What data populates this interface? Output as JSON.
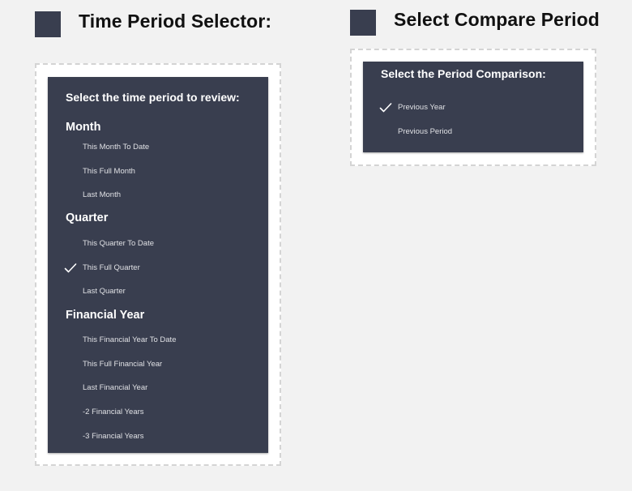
{
  "colors": {
    "panel_bg": "#393e4f",
    "page_bg": "#f2f2f2",
    "title_text": "#111111",
    "option_text": "#dfe0e4"
  },
  "time_selector": {
    "title": "Time Period Selector:",
    "heading": "Select the time period to review:",
    "groups": [
      {
        "label": "Month",
        "options": [
          {
            "label": "This Month To Date",
            "selected": false
          },
          {
            "label": "This Full Month",
            "selected": false
          },
          {
            "label": "Last Month",
            "selected": false
          }
        ]
      },
      {
        "label": "Quarter",
        "options": [
          {
            "label": "This Quarter To Date",
            "selected": false
          },
          {
            "label": "This Full Quarter",
            "selected": true
          },
          {
            "label": "Last Quarter",
            "selected": false
          }
        ]
      },
      {
        "label": "Financial Year",
        "options": [
          {
            "label": "This Financial Year To Date",
            "selected": false
          },
          {
            "label": "This Full Financial Year",
            "selected": false
          },
          {
            "label": "Last Financial Year",
            "selected": false
          },
          {
            "label": "-2 Financial Years",
            "selected": false
          },
          {
            "label": "-3 Financial Years",
            "selected": false
          }
        ]
      }
    ]
  },
  "compare_selector": {
    "title": "Select Compare Period",
    "heading": "Select the Period Comparison:",
    "options": [
      {
        "label": "Previous Year",
        "selected": true
      },
      {
        "label": "Previous Period",
        "selected": false
      }
    ]
  },
  "icons": {
    "check": "checkmark-icon"
  }
}
